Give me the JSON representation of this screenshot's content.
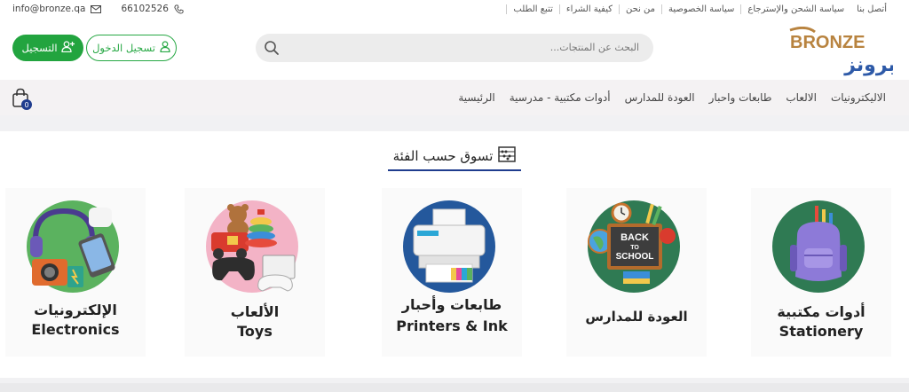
{
  "topbar": {
    "links": [
      "تتبع الطلب",
      "كيفية الشراء",
      "من نحن",
      "سياسة الخصوصية",
      "سياسة الشحن والإسترجاع",
      "أتصل بنا"
    ],
    "email": "info@bronze.qa",
    "phone": "66102526"
  },
  "header": {
    "logo_en": "BRONZE",
    "logo_ar": "برونز",
    "search_placeholder": "البحث عن المنتجات...",
    "login_label": "تسجيل الدخول",
    "register_label": "التسجيل"
  },
  "nav": {
    "items": [
      "الرئيسية",
      "أدوات مكتبية - مدرسية",
      "العودة للمدارس",
      "طابعات واحبار",
      "الالعاب",
      "الاليكترونيات"
    ],
    "cart_count": "0"
  },
  "categories_section": {
    "title": "تسوق حسب الفئة",
    "cards": [
      {
        "ar": "أدوات مكتبية",
        "en": "Stationery",
        "icon": "backpack-icon"
      },
      {
        "ar": "العودة للمدارس",
        "en": "",
        "icon": "back-to-school-icon"
      },
      {
        "ar": "طابعات وأحبار",
        "en": "Printers & Ink",
        "icon": "printer-icon"
      },
      {
        "ar": "الألعاب",
        "en": "Toys",
        "icon": "toys-icon"
      },
      {
        "ar": "الإلكترونيات",
        "en": "Electronics",
        "icon": "electronics-icon"
      }
    ],
    "back_to_school_sign": [
      "BACK",
      "TO",
      "SCHOOL"
    ]
  },
  "colors": {
    "green": "#22a43f",
    "navy": "#1f3c8e",
    "bronze": "#b8833f",
    "logo_blue": "#2e5aa8"
  }
}
